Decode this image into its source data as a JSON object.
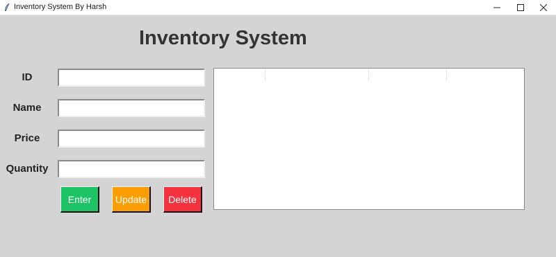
{
  "window": {
    "title": "Inventory System By Harsh",
    "icon": "feather-icon",
    "controls": [
      "minimize",
      "maximize",
      "close"
    ]
  },
  "heading": "Inventory System",
  "form": {
    "id_label": "ID",
    "id_value": "",
    "name_label": "Name",
    "name_value": "",
    "price_label": "Price",
    "price_value": "",
    "quantity_label": "Quantity",
    "quantity_value": ""
  },
  "buttons": {
    "enter_label": "Enter",
    "enter_color": "#1ec365",
    "update_label": "Update",
    "update_color": "#fb9e06",
    "delete_label": "Delete",
    "delete_color": "#f5333f"
  },
  "table": {
    "columns": [
      "",
      "",
      "",
      ""
    ],
    "rows": []
  }
}
